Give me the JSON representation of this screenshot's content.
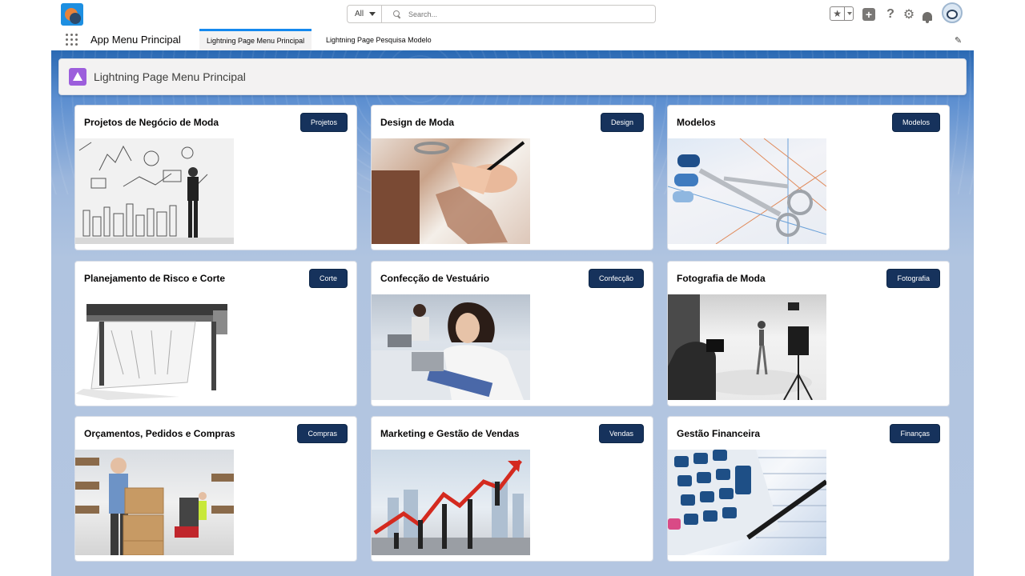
{
  "header": {
    "search_scope": "All",
    "search_placeholder": "Search..."
  },
  "context": {
    "app_name": "App Menu Principal",
    "tabs": [
      {
        "label": "Lightning Page Menu Principal",
        "active": true
      },
      {
        "label": "Lightning Page Pesquisa Modelo",
        "active": false
      }
    ]
  },
  "page": {
    "title": "Lightning Page Menu Principal"
  },
  "cards": [
    {
      "title": "Projetos de Negócio de Moda",
      "button": "Projetos"
    },
    {
      "title": "Design de Moda",
      "button": "Design"
    },
    {
      "title": "Modelos",
      "button": "Modelos"
    },
    {
      "title": "Planejamento de Risco e Corte",
      "button": "Corte"
    },
    {
      "title": "Confecção de Vestuário",
      "button": "Confecção"
    },
    {
      "title": "Fotografia de Moda",
      "button": "Fotografia"
    },
    {
      "title": "Orçamentos, Pedidos e Compras",
      "button": "Compras"
    },
    {
      "title": "Marketing e Gestão de Vendas",
      "button": "Vendas"
    },
    {
      "title": "Gestão Financeira",
      "button": "Finanças"
    }
  ],
  "colors": {
    "brand_button": "#16325c",
    "active_tab_accent": "#1589ee",
    "page_icon": "#9c5edc"
  }
}
